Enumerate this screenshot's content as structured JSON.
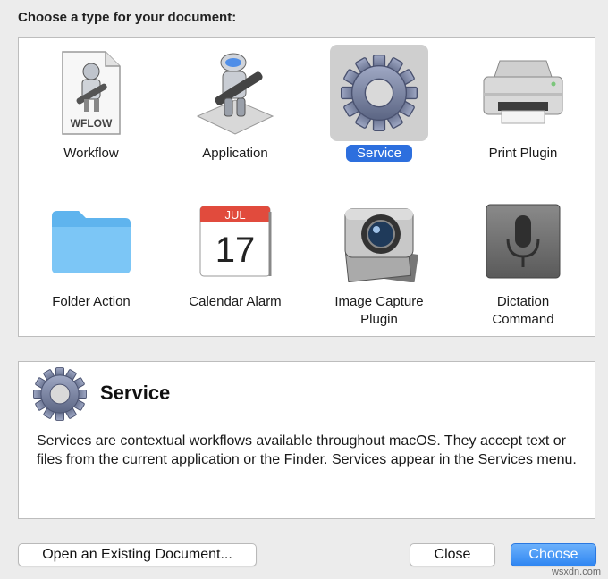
{
  "dialog": {
    "heading": "Choose a type for your document:"
  },
  "types": [
    {
      "label": "Workflow",
      "icon": "workflow-document-icon",
      "badge": "WFLOW"
    },
    {
      "label": "Application",
      "icon": "automator-robot-icon"
    },
    {
      "label": "Service",
      "icon": "gear-icon",
      "selected": true
    },
    {
      "label": "Print Plugin",
      "icon": "printer-icon"
    },
    {
      "label": "Folder Action",
      "icon": "folder-icon"
    },
    {
      "label": "Calendar Alarm",
      "icon": "calendar-icon",
      "month": "JUL",
      "day": "17"
    },
    {
      "label": "Image Capture Plugin",
      "icon": "camera-icon"
    },
    {
      "label": "Dictation Command",
      "icon": "microphone-icon"
    }
  ],
  "description": {
    "title": "Service",
    "icon": "gear-icon",
    "text": "Services are contextual workflows available throughout macOS. They accept text or files from the current application or the Finder. Services appear in the Services menu."
  },
  "buttons": {
    "open_existing": "Open an Existing Document...",
    "close": "Close",
    "choose": "Choose"
  },
  "watermark": "wsxdn.com",
  "colors": {
    "selection_blue": "#2d6fde",
    "primary_button": "#2f86f2"
  }
}
